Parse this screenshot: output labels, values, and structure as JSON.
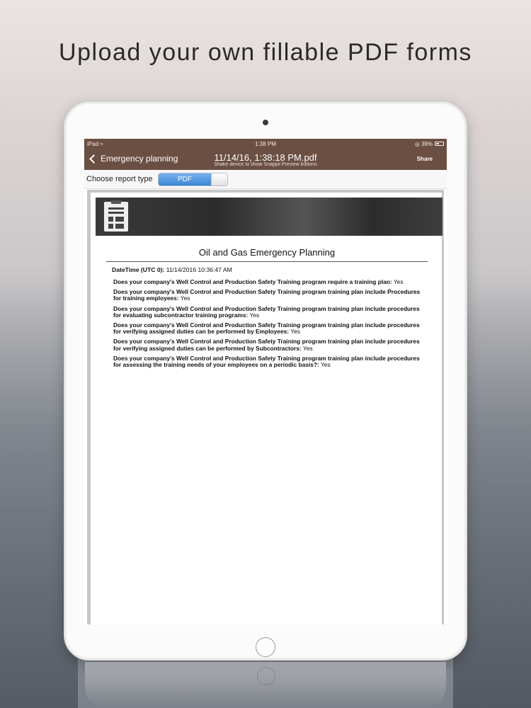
{
  "headline": "Upload your own fillable PDF forms",
  "status_bar": {
    "device": "iPad",
    "time": "1:38 PM",
    "battery": "39%"
  },
  "nav": {
    "back_label": "Emergency planning",
    "title": "11/14/16, 1:38:18 PM.pdf",
    "subtitle": "Shake device to show Snappii Preview buttons",
    "share_label": "Share"
  },
  "toolbar": {
    "label": "Choose report type",
    "selected_option": "PDF"
  },
  "document": {
    "title": "Oil and Gas Emergency Planning",
    "datetime_label": "DateTime (UTC 0):",
    "datetime_value": "11/14/2016 10:36:47 AM",
    "items": [
      {
        "question": "Does your company's Well Control and Production Safety Training program require a training plan:",
        "answer": "Yes"
      },
      {
        "question": "Does your company's Well Control and Production Safety Training program training plan include Procedures for training employees:",
        "answer": "Yes"
      },
      {
        "question": "Does your company's Well Control and Production Safety Training program training plan include procedures for evaluating subcontractor training programs:",
        "answer": "Yes"
      },
      {
        "question": "Does your company's Well Control and Production Safety Training program training plan include procedures for verifying assigned duties can be performed by Employees:",
        "answer": "Yes"
      },
      {
        "question": "Does your company's Well Control and Production Safety Training program training plan include procedures for verifying assigned duties can be performed by Subcontractors:",
        "answer": "Yes"
      },
      {
        "question": "Does your company's Well Control and Production Safety Training program training plan include procedures for assessing the training needs of your employees on a periodic basis?:",
        "answer": "Yes"
      }
    ]
  },
  "icons": {
    "back": "chevron-left-icon",
    "wifi": "wifi-icon",
    "battery": "battery-icon",
    "report": "clipboard-icon"
  },
  "colors": {
    "nav_background": "#6b4f42",
    "segment_selected": "#3b86d6",
    "banner": "#2c2c2c"
  }
}
